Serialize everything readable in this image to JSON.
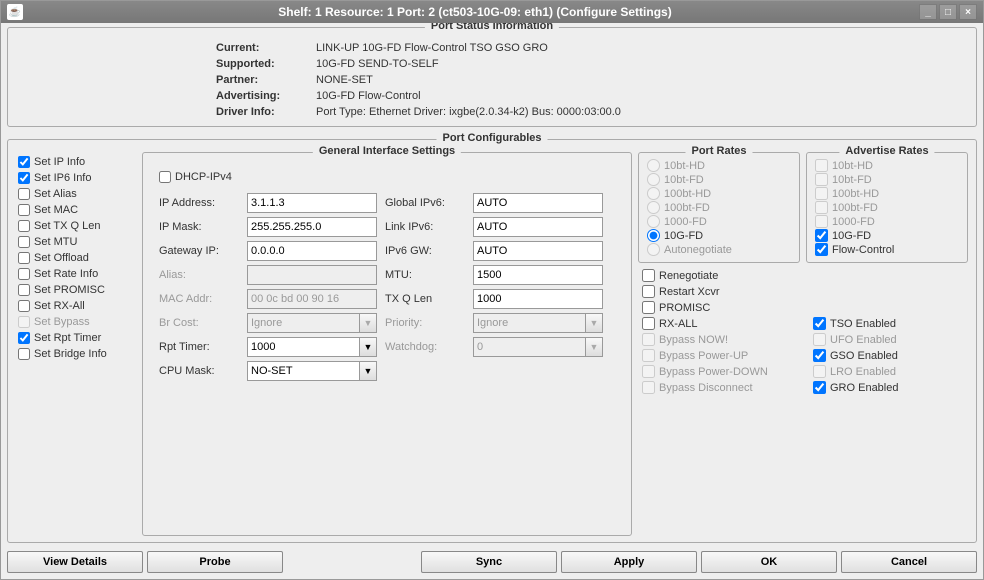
{
  "window": {
    "title": "Shelf: 1  Resource: 1  Port: 2  (ct503-10G-09: eth1)  (Configure Settings)"
  },
  "status": {
    "title": "Port Status Information",
    "rows": {
      "current_label": "Current:",
      "current_value": "LINK-UP 10G-FD Flow-Control TSO GSO GRO",
      "supported_label": "Supported:",
      "supported_value": "10G-FD SEND-TO-SELF",
      "partner_label": "Partner:",
      "partner_value": "NONE-SET",
      "advertising_label": "Advertising:",
      "advertising_value": "10G-FD Flow-Control",
      "driverinfo_label": "Driver Info:",
      "driverinfo_value": "Port Type: Ethernet   Driver: ixgbe(2.0.34-k2)   Bus: 0000:03:00.0"
    }
  },
  "config": {
    "title": "Port Configurables",
    "left": {
      "set_ip": "Set IP Info",
      "set_ip6": "Set IP6 Info",
      "set_alias": "Set Alias",
      "set_mac": "Set MAC",
      "set_txq": "Set TX Q Len",
      "set_mtu": "Set MTU",
      "set_offload": "Set Offload",
      "set_rate": "Set Rate Info",
      "set_promisc": "Set PROMISC",
      "set_rxall": "Set RX-All",
      "set_bypass": "Set Bypass",
      "set_rpt": "Set Rpt Timer",
      "set_bridge": "Set Bridge Info"
    },
    "gis": {
      "title": "General Interface Settings",
      "dhcp": "DHCP-IPv4",
      "ip_addr_lbl": "IP Address:",
      "ip_addr": "3.1.1.3",
      "global_ipv6_lbl": "Global IPv6:",
      "global_ipv6": "AUTO",
      "ip_mask_lbl": "IP Mask:",
      "ip_mask": "255.255.255.0",
      "link_ipv6_lbl": "Link IPv6:",
      "link_ipv6": "AUTO",
      "gw_lbl": "Gateway IP:",
      "gw": "0.0.0.0",
      "ipv6gw_lbl": "IPv6 GW:",
      "ipv6gw": "AUTO",
      "alias_lbl": "Alias:",
      "alias": "",
      "mtu_lbl": "MTU:",
      "mtu": "1500",
      "mac_lbl": "MAC Addr:",
      "mac": "00 0c bd 00 90 16",
      "txq_lbl": "TX Q Len",
      "txq": "1000",
      "brcost_lbl": "Br Cost:",
      "brcost": "Ignore",
      "priority_lbl": "Priority:",
      "priority": "Ignore",
      "rpt_lbl": "Rpt Timer:",
      "rpt": "1000",
      "watchdog_lbl": "Watchdog:",
      "watchdog": "0",
      "cpu_lbl": "CPU Mask:",
      "cpu": "NO-SET"
    },
    "port_rates": {
      "title": "Port Rates",
      "r10bt_hd": "10bt-HD",
      "r10bt_fd": "10bt-FD",
      "r100bt_hd": "100bt-HD",
      "r100bt_fd": "100bt-FD",
      "r1000_fd": "1000-FD",
      "r10g_fd": "10G-FD",
      "autoneg": "Autonegotiate"
    },
    "adv_rates": {
      "title": "Advertise Rates",
      "a10bt_hd": "10bt-HD",
      "a10bt_fd": "10bt-FD",
      "a100bt_hd": "100bt-HD",
      "a100bt_fd": "100bt-FD",
      "a1000_fd": "1000-FD",
      "a10g_fd": "10G-FD",
      "flow": "Flow-Control"
    },
    "misc": {
      "reneg": "Renegotiate",
      "restart": "Restart Xcvr",
      "promisc": "PROMISC",
      "rxall": "RX-ALL",
      "bypass_now": "Bypass NOW!",
      "bypass_up": "Bypass Power-UP",
      "bypass_down": "Bypass Power-DOWN",
      "bypass_disc": "Bypass Disconnect",
      "tso": "TSO Enabled",
      "ufo": "UFO Enabled",
      "gso": "GSO Enabled",
      "lro": "LRO Enabled",
      "gro": "GRO Enabled"
    }
  },
  "buttons": {
    "view": "View Details",
    "probe": "Probe",
    "sync": "Sync",
    "apply": "Apply",
    "ok": "OK",
    "cancel": "Cancel"
  }
}
